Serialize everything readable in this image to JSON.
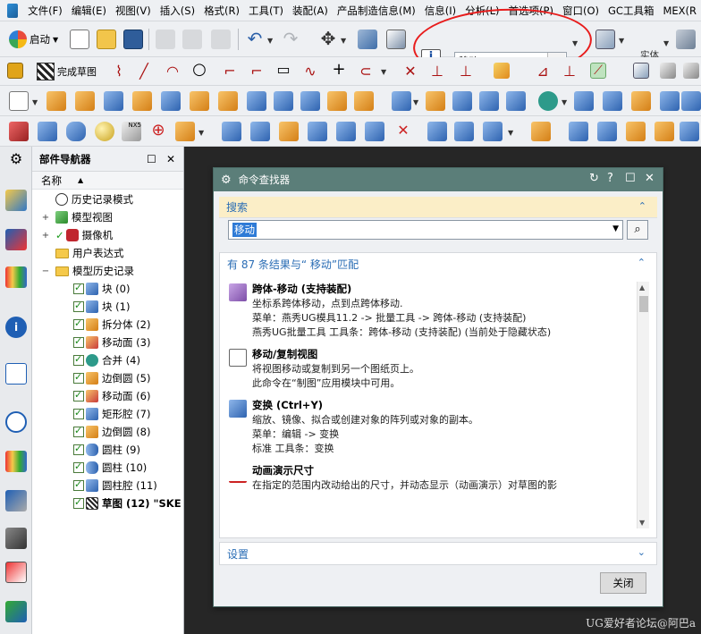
{
  "menubar": {
    "items": [
      "文件(F)",
      "编辑(E)",
      "视图(V)",
      "插入(S)",
      "格式(R)",
      "工具(T)",
      "装配(A)",
      "产品制造信息(M)",
      "信息(I)",
      "分析(L)",
      "首选项(P)",
      "窗口(O)",
      "GC工具箱",
      "MEX(R"
    ]
  },
  "toolbar": {
    "start_label": "启动",
    "finish_sketch_label": "完成草图",
    "command_search_value": "移动",
    "render_style_label": "实体",
    "render_style_sub": "颜色"
  },
  "navigator": {
    "title": "部件导航器",
    "column_name": "名称",
    "items": [
      {
        "label": "历史记录模式"
      },
      {
        "label": "模型视图"
      },
      {
        "label": "摄像机"
      },
      {
        "label": "用户表达式"
      },
      {
        "label": "模型历史记录"
      },
      {
        "label": "块 (0)"
      },
      {
        "label": "块 (1)"
      },
      {
        "label": "拆分体 (2)"
      },
      {
        "label": "移动面 (3)"
      },
      {
        "label": "合并 (4)"
      },
      {
        "label": "边倒圆 (5)"
      },
      {
        "label": "移动面 (6)"
      },
      {
        "label": "矩形腔 (7)"
      },
      {
        "label": "边倒圆 (8)"
      },
      {
        "label": "圆柱 (9)"
      },
      {
        "label": "圆柱 (10)"
      },
      {
        "label": "圆柱腔 (11)"
      },
      {
        "label": "草图 (12) \"SKE"
      }
    ]
  },
  "dialog": {
    "title": "命令查找器",
    "search_section": "搜索",
    "search_value": "移动",
    "results_header": "有 87 条结果与“ 移动”匹配",
    "results": [
      {
        "title": "跨体-移动 (支持装配)",
        "lines": [
          "坐标系跨体移动，点到点跨体移动.",
          "菜单：燕秀UG模具11.2 -> 批量工具 -> 跨体-移动 (支持装配)",
          "燕秀UG批量工具 工具条：跨体-移动 (支持装配)  (当前处于隐藏状态)"
        ]
      },
      {
        "title": "移动/复制视图",
        "lines": [
          "将视图移动或复制到另一个图纸页上。",
          "此命令在“制图”应用模块中可用。"
        ]
      },
      {
        "title": "变换 (Ctrl+Y)",
        "lines": [
          "缩放、镜像、拟合或创建对象的阵列或对象的副本。",
          "菜单：编辑 -> 变换",
          "标准 工具条：变换"
        ]
      },
      {
        "title": "动画演示尺寸",
        "lines": [
          "在指定的范围内改动给出的尺寸，并动态显示（动画演示）对草图的影"
        ]
      }
    ],
    "settings_section": "设置",
    "close_label": "关闭"
  },
  "watermark": "UG爱好者论坛@阿巴a",
  "colors": {
    "dialog_title_bg": "#5b7e79",
    "search_highlight": "#2f7bd6",
    "section_text": "#2a6db5",
    "annotation_red": "#e81c1c"
  }
}
